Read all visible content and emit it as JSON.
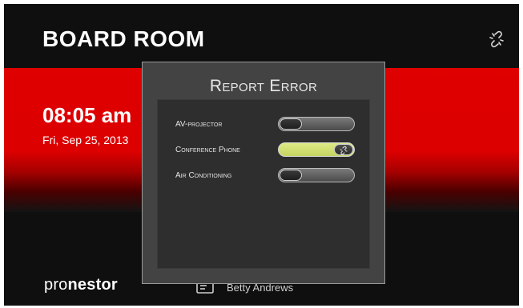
{
  "room": {
    "title": "BOARD ROOM"
  },
  "icons": {
    "header": "broken-link-icon",
    "organizer": "id-card-icon"
  },
  "clock": {
    "time": "08:05 am",
    "date": "Fri, Sep 25, 2013"
  },
  "brand": {
    "part1": "pro",
    "part2": "nestor"
  },
  "meeting": {
    "organizer": "Betty Andrews"
  },
  "dialog": {
    "title": "Report Error",
    "devices": [
      {
        "label": "AV-projector",
        "error": false
      },
      {
        "label": "Conference Phone",
        "error": true
      },
      {
        "label": "Air Conditioning",
        "error": false
      }
    ]
  },
  "colors": {
    "accent_red": "#df0000",
    "toggle_on": "#d3e073",
    "background": "#0f0f0f"
  }
}
